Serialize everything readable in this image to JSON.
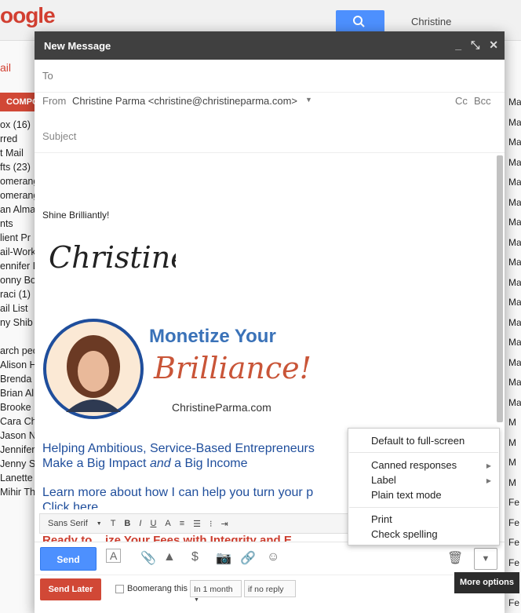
{
  "background": {
    "logo_fragment": "oogle",
    "user_name": "Christine",
    "mail_label": "ail",
    "compose_label": "COMPO",
    "left_items": [
      "ox (16)",
      "rred",
      "t Mail",
      "fts (23)",
      "omerang",
      "omerang",
      "an Alman",
      "nts",
      "lient Pr",
      "ail-Work",
      "ennifer D",
      "onny Bov",
      "raci (1)",
      "ail List",
      "ny Shib",
      "",
      "arch peo",
      "Alison H",
      "Brenda",
      "Brian Al",
      "Brooke",
      "Cara Ch",
      "Jason N",
      "Jennifer",
      "Jenny S",
      "Lanette",
      "Mihir Th"
    ],
    "right_items": [
      "Ma",
      "Ma",
      "Ma",
      "Ma",
      "Ma",
      "Ma",
      "Ma",
      "Ma",
      "Ma",
      "Ma",
      "Ma",
      "Ma",
      "Ma",
      "Ma",
      "Ma",
      "Ma",
      "M",
      "M",
      "M",
      "M",
      "Fe",
      "Fe",
      "Fe",
      "Fe",
      "Fe",
      "Fe"
    ]
  },
  "compose": {
    "title": "New Message",
    "to_label": "To",
    "from_label": "From",
    "from_value": "Christine Parma <christine@christineparma.com>",
    "cc": "Cc",
    "bcc": "Bcc",
    "subject_placeholder": "Subject",
    "signoff": "Shine Brilliantly!",
    "signature_script": "Christine",
    "banner_heading": "Monetize Your",
    "banner_script": "Brilliance!",
    "banner_url": "ChristineParma.com",
    "body_line1": "Helping Ambitious, Service-Based Entrepreneurs",
    "body_line2_a": "Make a Big Impact ",
    "body_line2_b": "and",
    "body_line2_c": " a Big Income",
    "body_line3": "Learn more about how I can help you turn your p",
    "click_here": "Click here",
    "ready_line": "Ready to ...ize Your Fees with Integrity and E..."
  },
  "format_bar": {
    "font": "Sans Serif",
    "size_icon": "T",
    "bold": "B",
    "italic": "I",
    "underline": "U",
    "text_color": "A"
  },
  "actions": {
    "send": "Send",
    "send_later": "Send Later",
    "boomerang_label": "Boomerang this",
    "boomerang_time": "In 1 month",
    "boomerang_cond": "if no reply"
  },
  "menu": {
    "items": [
      "Default to full-screen",
      "Canned responses",
      "Label",
      "Plain text mode",
      "Print",
      "Check spelling"
    ]
  },
  "tooltip": "More options",
  "colors": {
    "accent": "#4d90fe",
    "later": "#d14836",
    "titlebar": "#404040"
  }
}
